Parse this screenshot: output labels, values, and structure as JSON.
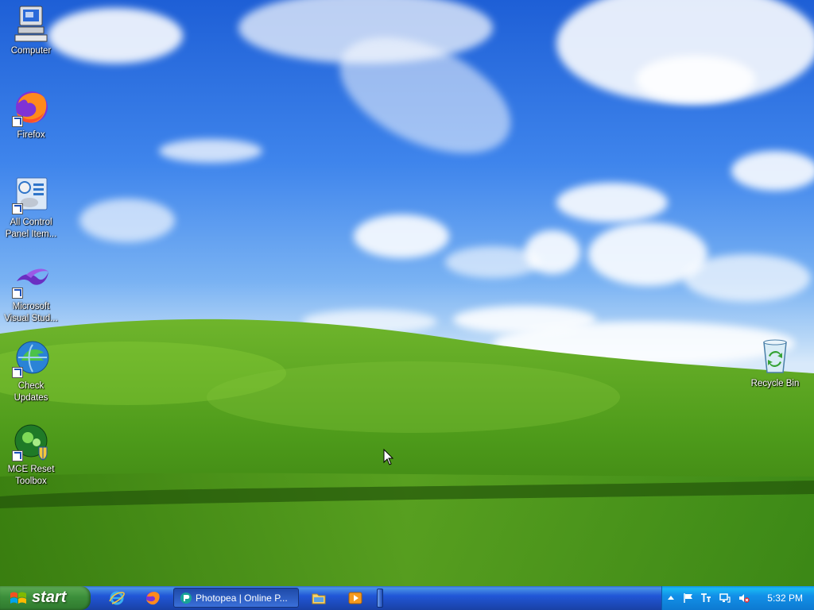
{
  "desktop": {
    "icons": [
      {
        "label": "Computer",
        "icon": "computer-icon"
      },
      {
        "label": "Firefox",
        "icon": "firefox-icon"
      },
      {
        "label": "All Control Panel Item...",
        "icon": "control-panel-icon"
      },
      {
        "label": "Microsoft Visual Stud...",
        "icon": "visual-studio-icon"
      },
      {
        "label": "Check Updates",
        "icon": "check-updates-icon"
      },
      {
        "label": "MCE Reset Toolbox",
        "icon": "mce-reset-toolbox-icon"
      },
      {
        "label": "Recycle Bin",
        "icon": "recycle-bin-icon"
      }
    ]
  },
  "taskbar": {
    "start_label": "start",
    "quick_launch": [
      "internet-explorer-icon",
      "firefox-icon"
    ],
    "task_button_label": "Photopea | Online P...",
    "pinned": [
      "explorer-folder-icon",
      "media-player-icon"
    ],
    "clock": "5:32 PM",
    "tray_icons": [
      "show-hidden-icon",
      "flag-icon",
      "language-icon",
      "network-icon",
      "volume-muted-icon"
    ]
  },
  "colors": {
    "taskbar_blue": "#245edc",
    "start_green": "#3c8f3b",
    "tray_blue": "#1290e8"
  }
}
